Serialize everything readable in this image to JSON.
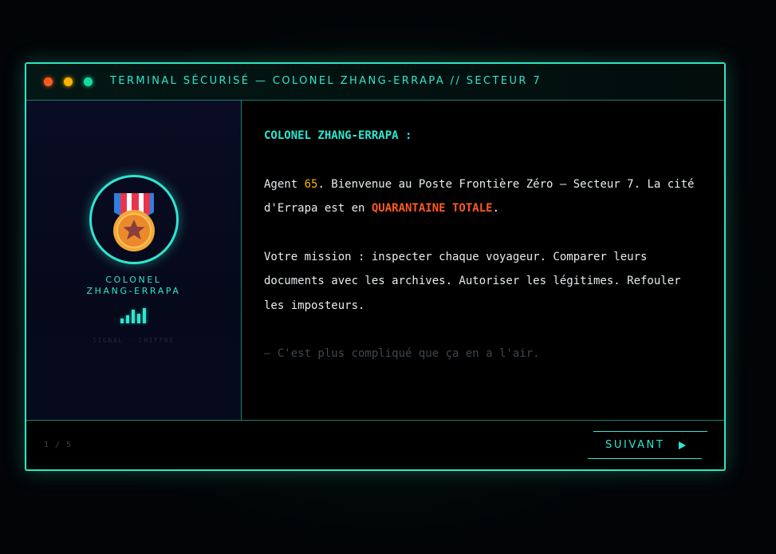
{
  "window": {
    "title": "TERMINAL SÉCURISÉ — COLONEL ZHANG-ERRAPA // SECTEUR 7"
  },
  "sidebar": {
    "speaker_name_line1": "COLONEL",
    "speaker_name_line2": "ZHANG-ERRAPA",
    "avatar_icon": "medal-icon",
    "signal_icon": "signal-bars-icon",
    "signal_caption": "SIGNAL · CHIFFRÉ"
  },
  "dialogue": {
    "speaker_label": "COLONEL ZHANG-ERRAPA :",
    "p1_before_num": "Agent ",
    "agent_number": "65",
    "p1_after_num": ". Bienvenue au Poste Frontière Zéro — Secteur 7. La cité d'Errapa est en ",
    "alert_text": "QUARANTAINE TOTALE",
    "p1_end": ".",
    "p2": "Votre mission : inspecter chaque voyageur. Comparer leurs documents avec les archives. Autoriser les légitimes. Refouler les imposteurs.",
    "aside": "— C'est plus compliqué que ça en a l'air."
  },
  "footer": {
    "page_counter": "1 / 5",
    "next_label": "SUIVANT",
    "next_icon": "play-icon"
  },
  "colors": {
    "accent": "#2ee6d0",
    "warning": "#ff5a1f",
    "highlight": "#ffb300"
  }
}
